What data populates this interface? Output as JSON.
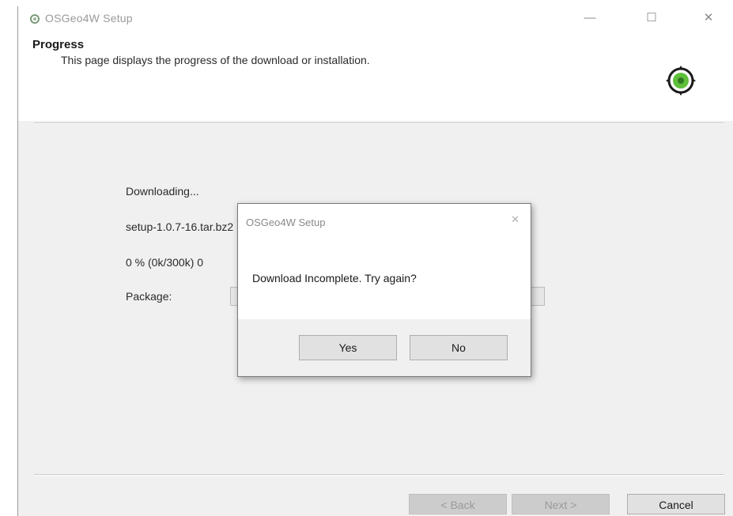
{
  "window": {
    "title": "OSGeo4W Setup",
    "controls": {
      "minimize": "—",
      "maximize": "☐",
      "close": "✕"
    }
  },
  "header": {
    "title": "Progress",
    "subtitle": "This page displays the progress of the download or installation.",
    "logo_icon": "osgeo4w-logo-icon"
  },
  "progress": {
    "status_label": "Downloading...",
    "file_line": "setup-1.0.7-16.tar.bz2",
    "percent_line": "0 %  (0k/300k)  0",
    "package_label": "Package:"
  },
  "dialog": {
    "title": "OSGeo4W Setup",
    "close": "✕",
    "message": "Download Incomplete.  Try again?",
    "yes_label": "Yes",
    "no_label": "No"
  },
  "footer": {
    "back_label": "< Back",
    "next_label": "Next >",
    "cancel_label": "Cancel"
  },
  "colors": {
    "window_bg": "#f0f0f0",
    "header_bg": "#ffffff",
    "logo_green": "#5fbf3a",
    "logo_dark": "#1a1a1a"
  }
}
